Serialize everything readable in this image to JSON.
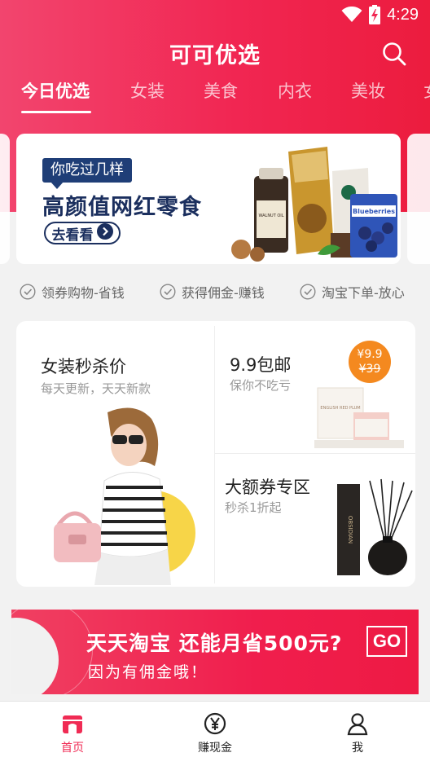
{
  "status_bar": {
    "time": "4:29"
  },
  "header": {
    "title": "可可优选"
  },
  "tabs": [
    {
      "label": "今日优选",
      "active": true
    },
    {
      "label": "女装"
    },
    {
      "label": "美食"
    },
    {
      "label": "内衣"
    },
    {
      "label": "美妆"
    },
    {
      "label": "女"
    }
  ],
  "banner": {
    "tag": "你吃过几样",
    "headline": "高颜值网红零食",
    "button_label": "去看看",
    "product_labels": {
      "walnut": "WALNUT OIL",
      "blueberries": "Blueberries"
    }
  },
  "benefits": [
    {
      "label": "领券购物-省钱"
    },
    {
      "label": "获得佣金-赚钱"
    },
    {
      "label": "淘宝下单-放心"
    }
  ],
  "promo": {
    "flash_sale": {
      "title": "女装秒杀价",
      "subtitle": "每天更新，天天新款"
    },
    "free_shipping": {
      "title": "9.9包邮",
      "subtitle": "保你不吃亏",
      "price_new": "¥9.9",
      "price_old": "¥39",
      "candle_text": "ENGLISH RED PLUM"
    },
    "big_coupon": {
      "title": "大额券专区",
      "subtitle": "秒杀1折起",
      "diffuser_text": "OBSIDIAN"
    }
  },
  "cash_banner": {
    "main": "天天淘宝 还能月省500元?",
    "sub": "因为有佣金哦！",
    "go_label": "GO"
  },
  "bottom_nav": [
    {
      "label": "首页",
      "icon": "home-shop-icon",
      "active": true
    },
    {
      "label": "赚现金",
      "icon": "yen-coin-icon"
    },
    {
      "label": "我",
      "icon": "person-icon"
    }
  ],
  "colors": {
    "primary": "#f02b54",
    "navy": "#1b2f5e",
    "orange_badge": "#f4891f"
  }
}
